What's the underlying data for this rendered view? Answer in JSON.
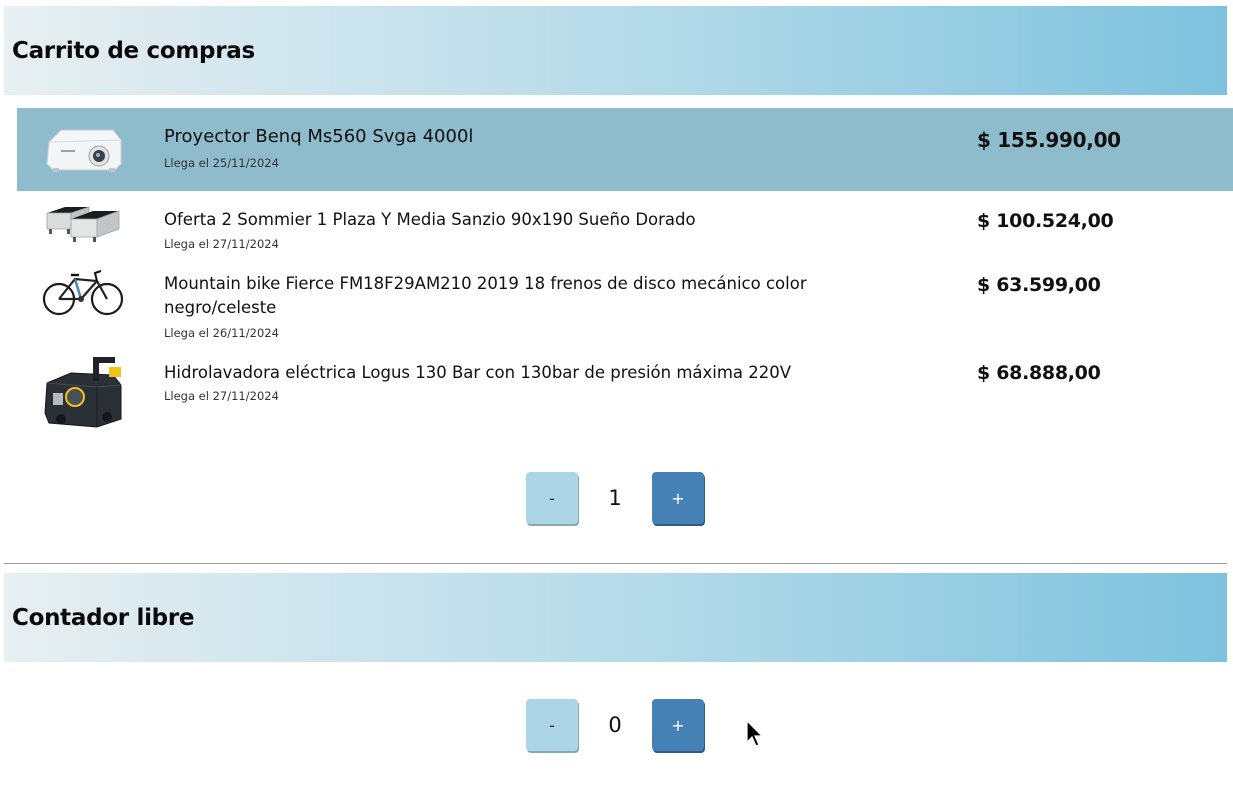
{
  "cart_section": {
    "title": "Carrito de compras",
    "items": [
      {
        "title": "Proyector Benq Ms560 Svga 4000l",
        "eta": "Llega el 25/11/2024",
        "price": "$ 155.990,00",
        "icon": "projector-icon",
        "selected": true
      },
      {
        "title": "Oferta 2 Sommier 1 Plaza Y Media Sanzio 90x190 Sueño Dorado",
        "eta": "Llega el 27/11/2024",
        "price": "$ 100.524,00",
        "icon": "mattress-icon",
        "selected": false
      },
      {
        "title": "Mountain bike Fierce FM18F29AM210 2019 18 frenos de disco mecánico color negro/celeste",
        "eta": "Llega el 26/11/2024",
        "price": "$ 63.599,00",
        "icon": "bicycle-icon",
        "selected": false
      },
      {
        "title": "Hidrolavadora eléctrica Logus 130 Bar con 130bar de presión máxima 220V",
        "eta": "Llega el 27/11/2024",
        "price": "$ 68.888,00",
        "icon": "pressure-washer-icon",
        "selected": false
      }
    ],
    "counter": {
      "minus_label": "-",
      "value": "1",
      "plus_label": "+"
    }
  },
  "free_counter_section": {
    "title": "Contador libre",
    "counter": {
      "minus_label": "-",
      "value": "0",
      "plus_label": "+"
    }
  },
  "colors": {
    "header_gradient_start": "#e8eff1",
    "header_gradient_end": "#7ec2de",
    "selected_row": "#8fbccd",
    "minus_button": "#acd6e8",
    "plus_button": "#4581b4"
  }
}
